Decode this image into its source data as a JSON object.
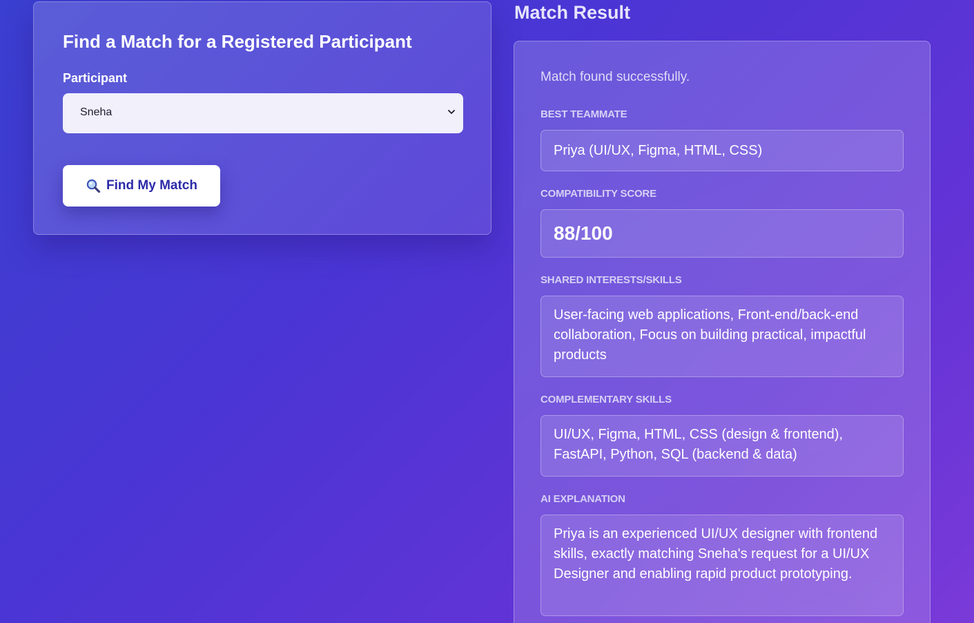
{
  "finder": {
    "title": "Find a Match for a Registered Participant",
    "participant_label": "Participant",
    "selected_participant": "Sneha",
    "button_label": "Find My Match",
    "button_icon": "magnifying-glass-icon"
  },
  "result": {
    "heading": "Match Result",
    "status": "Match found successfully.",
    "sections": {
      "best_teammate": {
        "label": "BEST TEAMMATE",
        "value": "Priya (UI/UX, Figma, HTML, CSS)"
      },
      "compatibility_score": {
        "label": "COMPATIBILITY SCORE",
        "value": "88/100"
      },
      "shared_interests": {
        "label": "SHARED INTERESTS/SKILLS",
        "value": "User-facing web applications, Front-end/back-end collaboration, Focus on building practical, impactful products"
      },
      "complementary_skills": {
        "label": "COMPLEMENTARY SKILLS",
        "value": "UI/UX, Figma, HTML, CSS (design & frontend), FastAPI, Python, SQL (backend & data)"
      },
      "ai_explanation": {
        "label": "AI EXPLANATION",
        "value": "Priya is an experienced UI/UX designer with frontend skills, exactly matching Sneha's request for a UI/UX Designer and enabling rapid product prototyping."
      }
    }
  },
  "colors": {
    "button_text": "#2c2aa8",
    "background_start": "#3a3fd0",
    "background_end": "#7a3ad8"
  }
}
